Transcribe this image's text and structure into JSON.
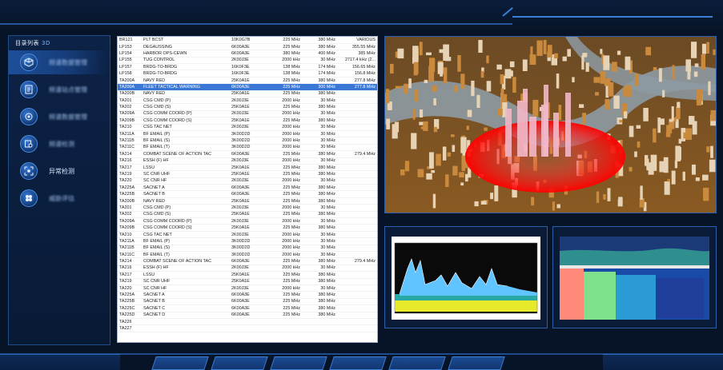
{
  "sidebar": {
    "title": "目录列表",
    "badge": "3D",
    "items": [
      {
        "label": "频谱数据管理",
        "icon": "cube-icon",
        "active": true
      },
      {
        "label": "频谱站点管理",
        "icon": "document-icon",
        "active": false
      },
      {
        "label": "频谱数据管理",
        "icon": "signal-icon",
        "active": false
      },
      {
        "label": "频谱检测",
        "icon": "search-doc-icon",
        "active": false
      },
      {
        "label": "异常检测",
        "icon": "scan-icon",
        "active": false
      },
      {
        "label": "威胁评估",
        "icon": "fan-icon",
        "active": false
      }
    ]
  },
  "table": {
    "selected_index": 7,
    "rows": [
      [
        "BR121",
        "PLT BCST",
        "10K0G7B",
        "225 MHz",
        "380 MHz",
        "VARIOUS"
      ],
      [
        "LP153",
        "DEGAUSSING",
        "6K00A3E",
        "225 MHz",
        "380 MHz",
        "355.55 MHz"
      ],
      [
        "LP154",
        "HARBOR OPS-CEWN",
        "6K00A3E",
        "380 MHz",
        "400 MHz",
        "385 MHz"
      ],
      [
        "LP155",
        "TUG CONTROL",
        "2K00J3E",
        "2000 kHz",
        "30 MHz",
        "2717.4 kHz (2..."
      ],
      [
        "LP157",
        "BRDG-TO-BRDG",
        "16K0F3E",
        "138 MHz",
        "174 MHz",
        "156.65 MHz"
      ],
      [
        "LP158",
        "BRDG-TO-BRDG",
        "16K0F3E",
        "138 MHz",
        "174 MHz",
        "156.8 MHz"
      ],
      [
        "TA200A",
        "NAVY RED",
        "25K0A1E",
        "225 MHz",
        "380 MHz",
        "277.8 MHz"
      ],
      [
        "TA200A",
        "FLEET TACTICAL WARNING",
        "6K00A3E",
        "225 MHz",
        "300 MHz",
        "277.8 MHz"
      ],
      [
        "TA200B",
        "NAVY RED",
        "25K0A1E",
        "225 MHz",
        "380 MHz",
        ""
      ],
      [
        "TA201",
        "CSG CMD (P)",
        "2K00J3E",
        "2000 kHz",
        "30 MHz",
        ""
      ],
      [
        "TA202",
        "CSG CMD (S)",
        "25K0A1E",
        "225 MHz",
        "380 MHz",
        ""
      ],
      [
        "TA209A",
        "CSG COMM COORD (P)",
        "2K00J3E",
        "2000 kHz",
        "30 MHz",
        ""
      ],
      [
        "TA209B",
        "CSG COMM COORD (S)",
        "25K0A1E",
        "225 MHz",
        "380 MHz",
        ""
      ],
      [
        "TA210",
        "CSG TAC NET",
        "2K00J3E",
        "2000 kHz",
        "30 MHz",
        ""
      ],
      [
        "TA211A",
        "BF EMAIL (P)",
        "3K00D2D",
        "2000 kHz",
        "30 MHz",
        ""
      ],
      [
        "TA211B",
        "BF EMAIL (S)",
        "3K00D2D",
        "2000 kHz",
        "30 MHz",
        ""
      ],
      [
        "TA211C",
        "BF EMAIL (T)",
        "3K00D2D",
        "2000 kHz",
        "30 MHz",
        ""
      ],
      [
        "TA214",
        "COMBAT SCENE OF ACTION TAC",
        "6K00A3E",
        "225 MHz",
        "380 MHz",
        "279.4 MHz"
      ],
      [
        "TA216",
        "ESSH (F) HF",
        "2K00J3E",
        "2000 kHz",
        "30 MHz",
        ""
      ],
      [
        "TA217",
        "LSSU",
        "25K0A1E",
        "225 MHz",
        "380 MHz",
        ""
      ],
      [
        "TA219",
        "SC CNR UHF",
        "25K0A1E",
        "225 MHz",
        "380 MHz",
        ""
      ],
      [
        "TA220",
        "SC CNR HF",
        "2K00J3E",
        "2000 kHz",
        "30 MHz",
        ""
      ],
      [
        "TA225A",
        "SACNET A",
        "6K00A3E",
        "225 MHz",
        "380 MHz",
        ""
      ],
      [
        "TA225B",
        "SACNET B",
        "6K00A3E",
        "225 MHz",
        "380 MHz",
        ""
      ],
      [
        "TA200B",
        "NAVY RED",
        "25K0A1E",
        "225 MHz",
        "380 MHz",
        ""
      ],
      [
        "TA201",
        "CSG CMD (P)",
        "2K00J3E",
        "2000 kHz",
        "30 MHz",
        ""
      ],
      [
        "TA202",
        "CSG CMD (S)",
        "25K0A1E",
        "225 MHz",
        "380 MHz",
        ""
      ],
      [
        "TA209A",
        "CSG COMM COORD (P)",
        "2K00J3E",
        "2000 kHz",
        "30 MHz",
        ""
      ],
      [
        "TA209B",
        "CSG COMM COORD (S)",
        "25K0A1E",
        "225 MHz",
        "380 MHz",
        ""
      ],
      [
        "TA210",
        "CSG TAC NET",
        "2K00J3E",
        "2000 kHz",
        "30 MHz",
        ""
      ],
      [
        "TA211A",
        "BF EMAIL (P)",
        "3K00D2D",
        "2000 kHz",
        "30 MHz",
        ""
      ],
      [
        "TA211B",
        "BF EMAIL (S)",
        "3K00D2D",
        "2000 kHz",
        "30 MHz",
        ""
      ],
      [
        "TA211C",
        "BF EMAIL (T)",
        "3K00D2D",
        "2000 kHz",
        "30 MHz",
        ""
      ],
      [
        "TA214",
        "COMBAT SCENE OF ACTION TAC",
        "6K00A3E",
        "225 MHz",
        "380 MHz",
        "279.4 MHz"
      ],
      [
        "TA216",
        "ESSH (F) HF",
        "2K00J3E",
        "2000 kHz",
        "30 MHz",
        ""
      ],
      [
        "TA217",
        "LSSU",
        "25K0A1E",
        "225 MHz",
        "380 MHz",
        ""
      ],
      [
        "TA219",
        "SC CNR UHF",
        "25K0A1E",
        "225 MHz",
        "380 MHz",
        ""
      ],
      [
        "TA220",
        "SC CNR HF",
        "2K00J3E",
        "2000 kHz",
        "30 MHz",
        ""
      ],
      [
        "TA225A",
        "SACNET A",
        "6K00A3E",
        "225 MHz",
        "380 MHz",
        ""
      ],
      [
        "TA225B",
        "SACNET B",
        "6K00A3E",
        "225 MHz",
        "380 MHz",
        ""
      ],
      [
        "TA225C",
        "SACNET C",
        "6K00A3E",
        "225 MHz",
        "380 MHz",
        ""
      ],
      [
        "TA225D",
        "SACNET D",
        "6K00A3E",
        "225 MHz",
        "380 MHz",
        ""
      ],
      [
        "TA226",
        "",
        "",
        "",
        "",
        ""
      ],
      [
        "TA227",
        "",
        "",
        "",
        "",
        ""
      ]
    ]
  },
  "colors": {
    "accent": "#2d66b8",
    "selection": "#3b78d6",
    "threat_ring": "#ff1a1a"
  },
  "bottom_tabs": [
    "",
    "",
    "",
    "",
    "",
    ""
  ]
}
